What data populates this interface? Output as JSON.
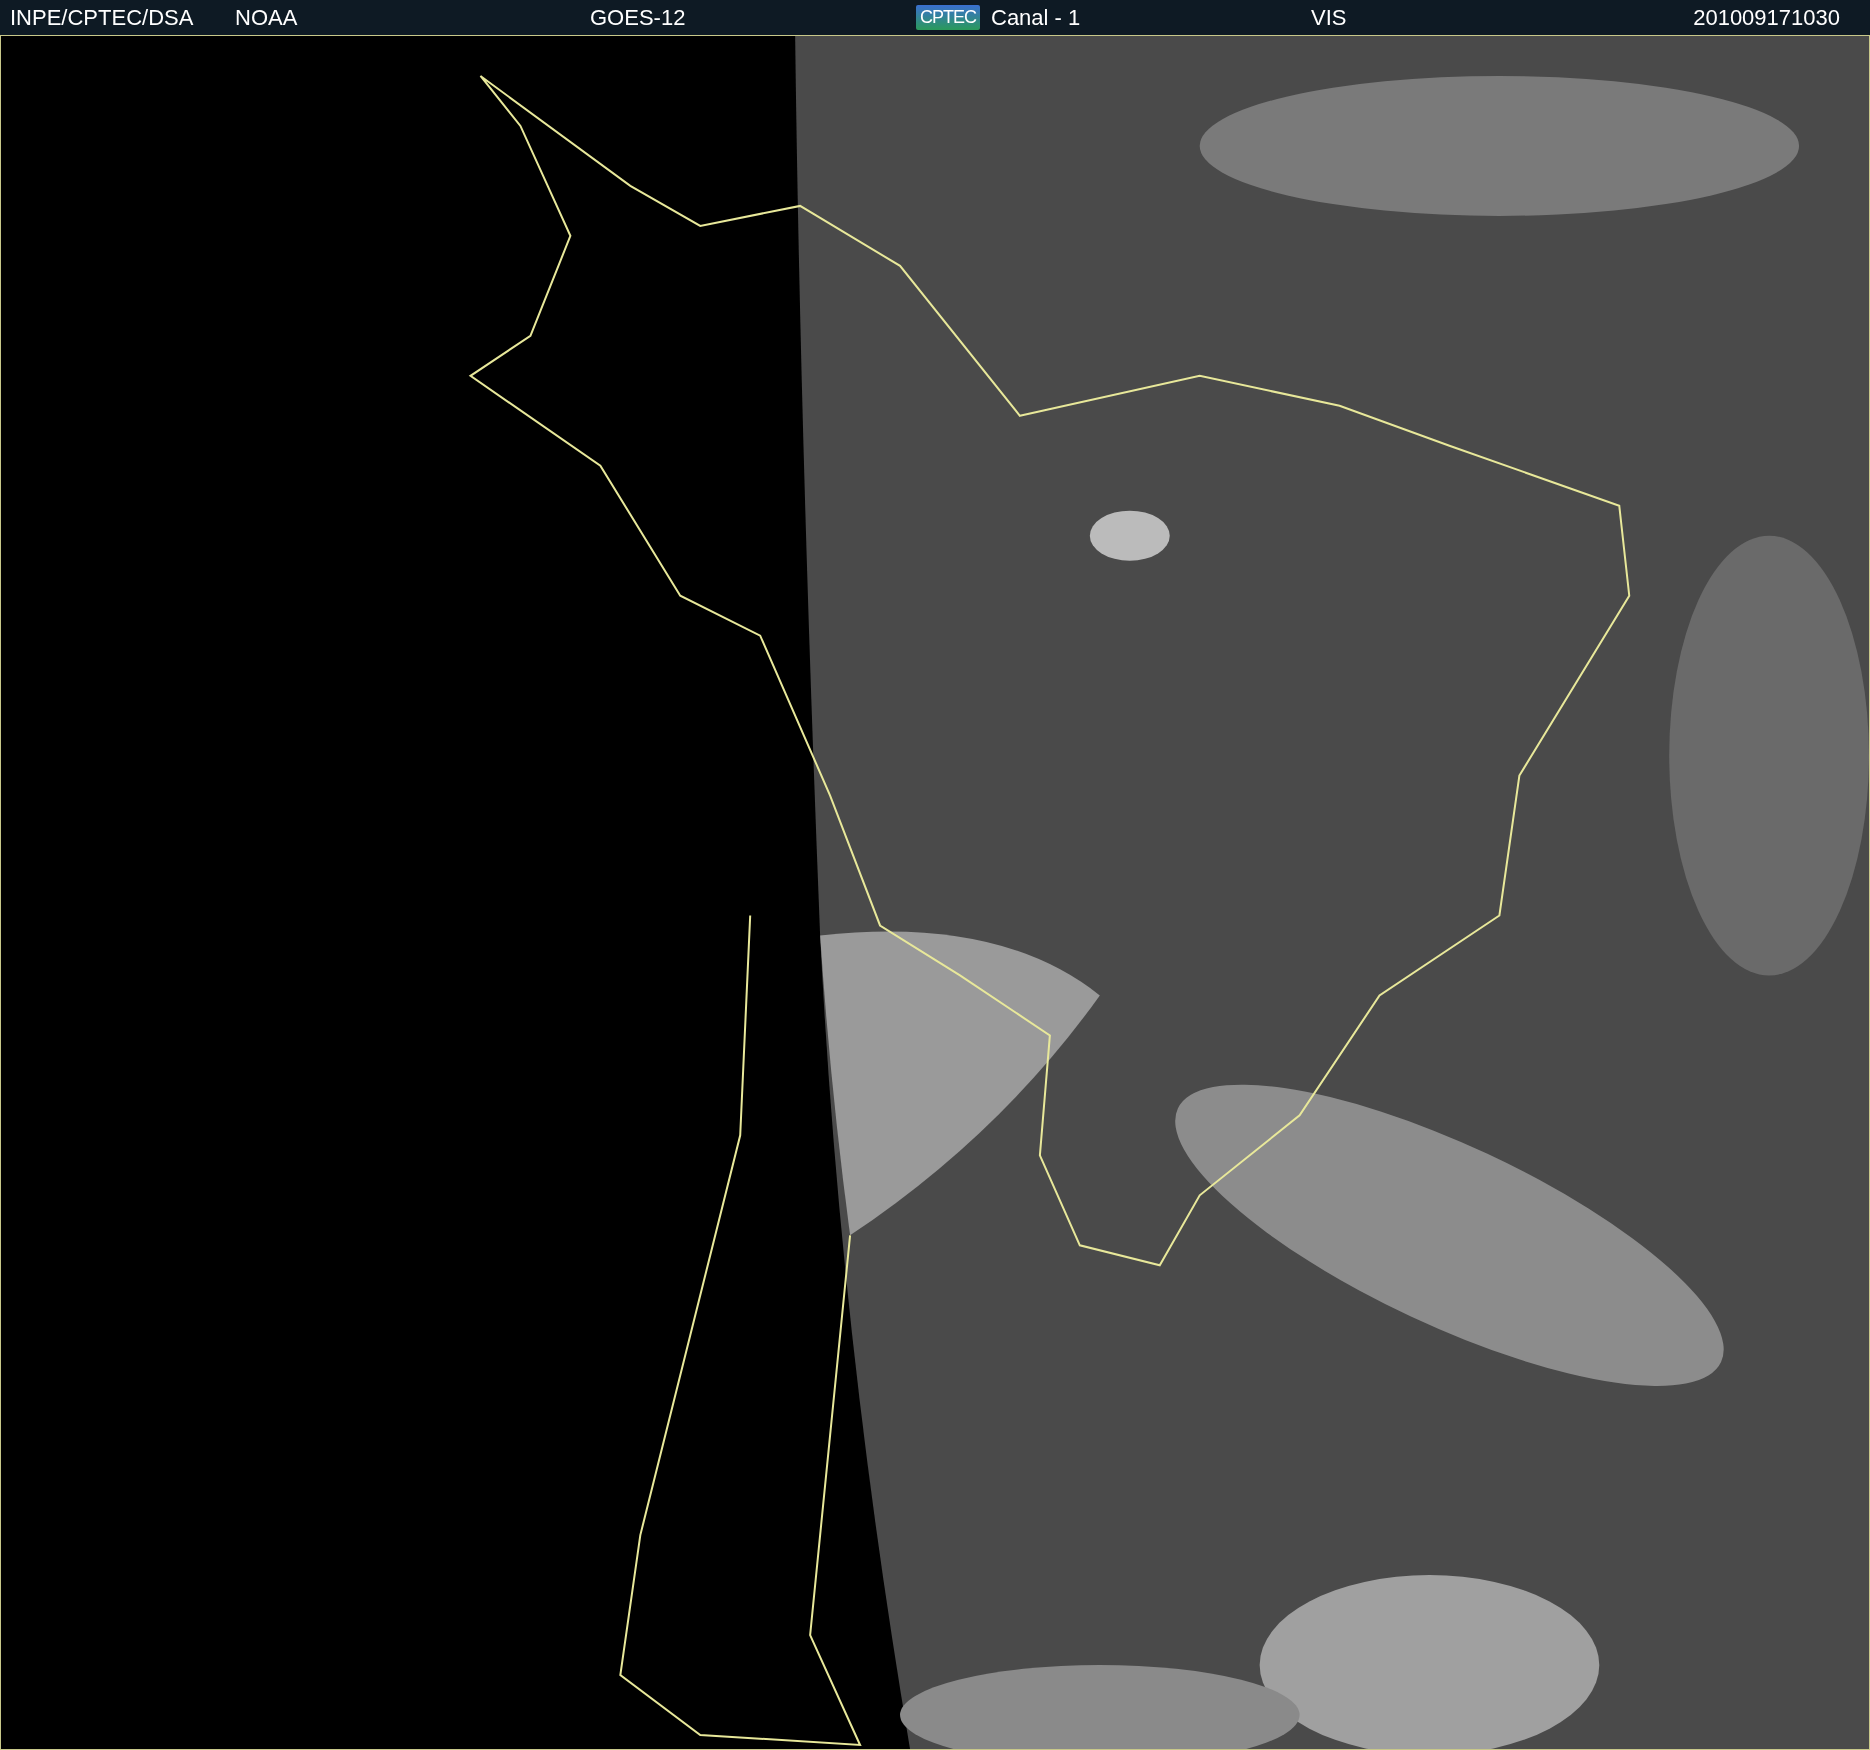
{
  "header": {
    "labels": [
      {
        "text": "INPE/CPTEC/DSA"
      },
      {
        "text": "NOAA"
      },
      {
        "text": "GOES-12"
      },
      {
        "text": "CPTEC",
        "kind": "logo"
      },
      {
        "text": "Canal - 1"
      },
      {
        "text": "VIS"
      },
      {
        "text": "201009171030"
      }
    ]
  }
}
